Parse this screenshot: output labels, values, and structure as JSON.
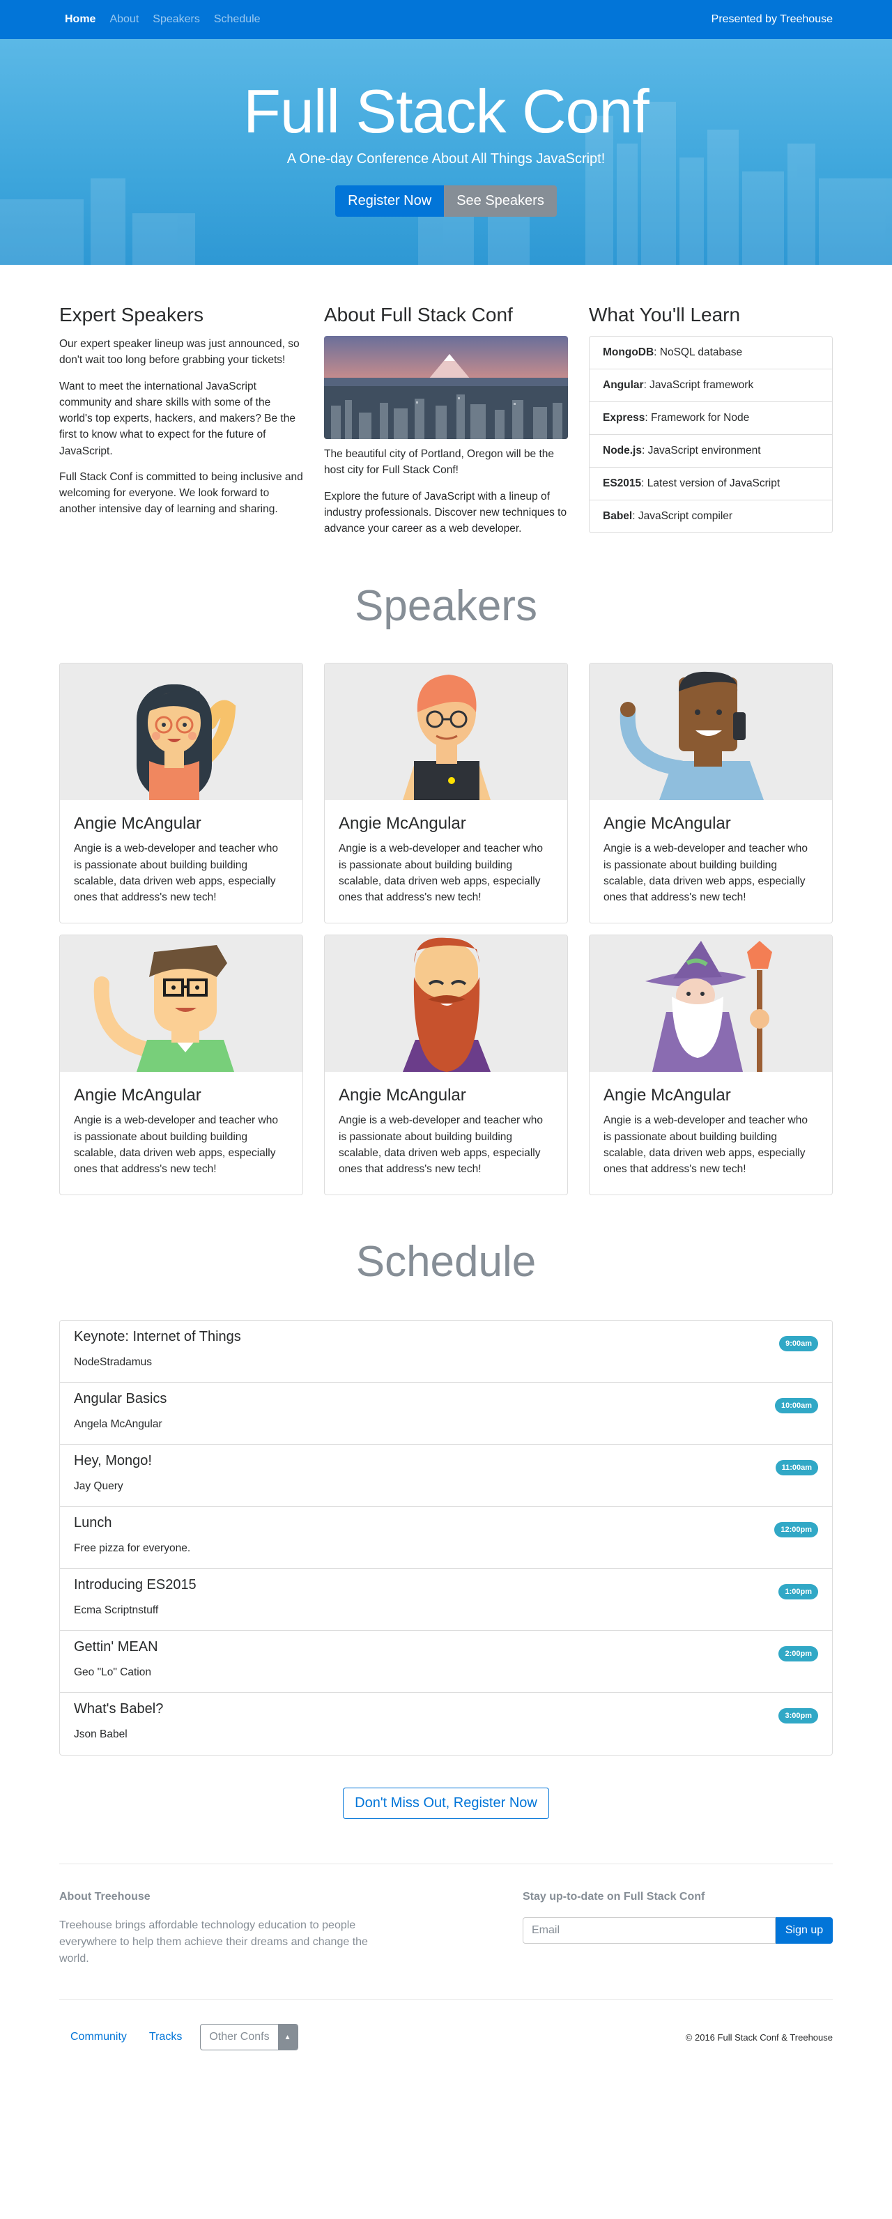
{
  "nav": {
    "links": [
      "Home",
      "About",
      "Speakers",
      "Schedule"
    ],
    "right": "Presented by Treehouse"
  },
  "hero": {
    "title": "Full Stack Conf",
    "subtitle": "A One-day Conference About All Things JavaScript!",
    "register_label": "Register Now",
    "speakers_label": "See Speakers"
  },
  "info": {
    "expert": {
      "title": "Expert Speakers",
      "paragraphs": [
        "Our expert speaker lineup was just announced, so don't wait too long before grabbing your tickets!",
        "Want to meet the international JavaScript community and share skills with some of the world's top experts, hackers, and makers? Be the first to know what to expect for the future of JavaScript.",
        "Full Stack Conf is committed to being inclusive and welcoming for everyone. We look forward to another intensive day of learning and sharing."
      ]
    },
    "about": {
      "title": "About Full Stack Conf",
      "paragraphs": [
        "The beautiful city of Portland, Oregon will be the host city for Full Stack Conf!",
        "Explore the future of JavaScript with a lineup of industry professionals. Discover new techniques to advance your career as a web developer."
      ]
    },
    "learn": {
      "title": "What You'll Learn",
      "items": [
        {
          "name": "MongoDB",
          "desc": ": NoSQL database"
        },
        {
          "name": "Angular",
          "desc": ": JavaScript framework"
        },
        {
          "name": "Express",
          "desc": ": Framework for Node"
        },
        {
          "name": "Node.js",
          "desc": ": JavaScript environment"
        },
        {
          "name": "ES2015",
          "desc": ": Latest version of JavaScript"
        },
        {
          "name": "Babel",
          "desc": ": JavaScript compiler"
        }
      ]
    }
  },
  "speakers": {
    "title": "Speakers",
    "cards": [
      {
        "name": "Angie McAngular",
        "bio": "Angie is a web-developer and teacher who is passionate about building building scalable, data driven web apps, especially ones that address's new tech!",
        "avatar": "avatar-girl-glasses"
      },
      {
        "name": "Angie McAngular",
        "bio": "Angie is a web-developer and teacher who is passionate about building building scalable, data driven web apps, especially ones that address's new tech!",
        "avatar": "avatar-redhead-glasses"
      },
      {
        "name": "Angie McAngular",
        "bio": "Angie is a web-developer and teacher who is passionate about building building scalable, data driven web apps, especially ones that address's new tech!",
        "avatar": "avatar-phone-man"
      },
      {
        "name": "Angie McAngular",
        "bio": "Angie is a web-developer and teacher who is passionate about building building scalable, data driven web apps, especially ones that address's new tech!",
        "avatar": "avatar-waving-glasses"
      },
      {
        "name": "Angie McAngular",
        "bio": "Angie is a web-developer and teacher who is passionate about building building scalable, data driven web apps, especially ones that address's new tech!",
        "avatar": "avatar-bearded-man"
      },
      {
        "name": "Angie McAngular",
        "bio": "Angie is a web-developer and teacher who is passionate about building building scalable, data driven web apps, especially ones that address's new tech!",
        "avatar": "avatar-wizard"
      }
    ]
  },
  "schedule": {
    "title": "Schedule",
    "items": [
      {
        "name": "Keynote: Internet of Things",
        "speaker": "NodeStradamus",
        "time": "9:00am"
      },
      {
        "name": "Angular Basics",
        "speaker": "Angela McAngular",
        "time": "10:00am"
      },
      {
        "name": "Hey, Mongo!",
        "speaker": "Jay Query",
        "time": "11:00am"
      },
      {
        "name": "Lunch",
        "speaker": "Free pizza for everyone.",
        "time": "12:00pm"
      },
      {
        "name": "Introducing ES2015",
        "speaker": "Ecma Scriptnstuff",
        "time": "1:00pm"
      },
      {
        "name": "Gettin' MEAN",
        "speaker": "Geo \"Lo\" Cation",
        "time": "2:00pm"
      },
      {
        "name": "What's Babel?",
        "speaker": "Json Babel",
        "time": "3:00pm"
      }
    ],
    "cta_label": "Don't Miss Out, Register Now"
  },
  "footer": {
    "about_title": "About Treehouse",
    "about_text": "Treehouse brings affordable technology education to people everywhere to help them achieve their dreams and change the world.",
    "newsletter_title": "Stay up-to-date on Full Stack Conf",
    "email_placeholder": "Email",
    "signup_label": "Sign up",
    "links": [
      "Community",
      "Tracks"
    ],
    "dropdown_label": "Other Confs",
    "copyright": "© 2016 Full Stack Conf & Treehouse"
  },
  "colors": {
    "primary": "#0275d8",
    "secondary": "#868e96",
    "badge": "#31a8c6",
    "hero": "#3ea6dc"
  }
}
